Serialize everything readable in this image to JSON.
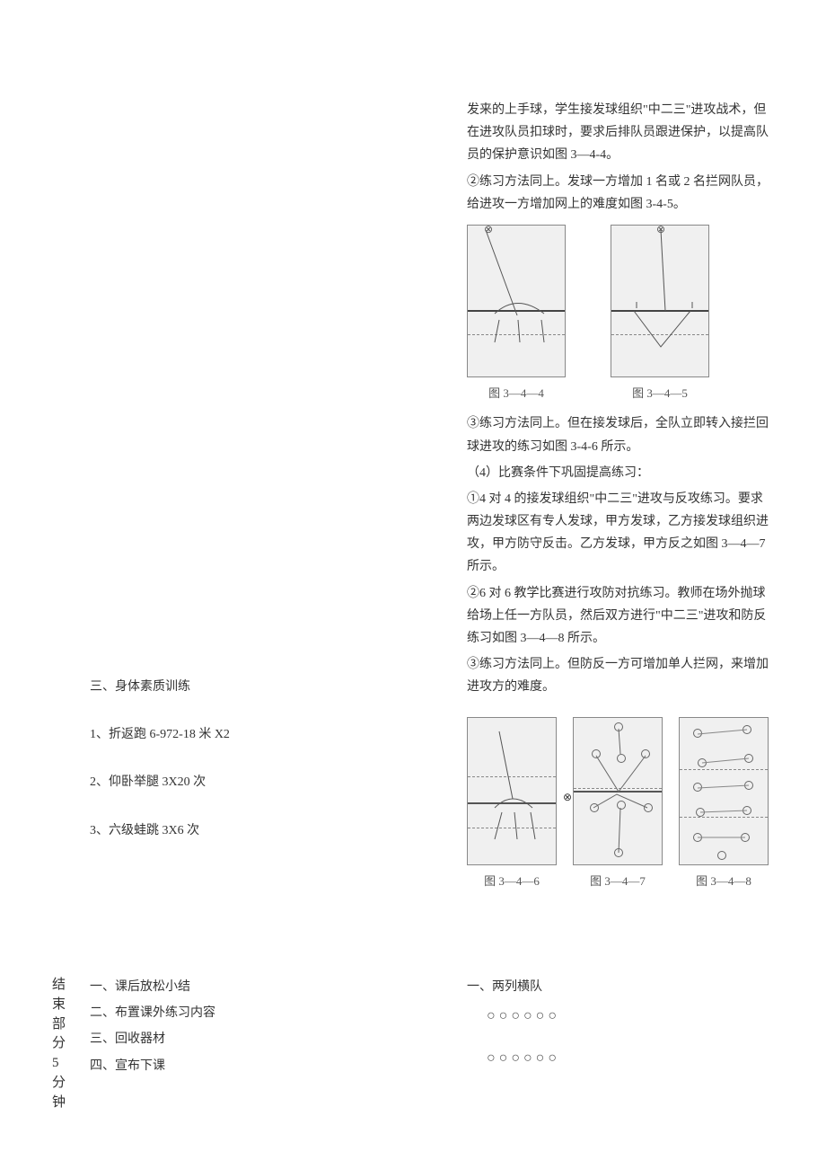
{
  "top_right": {
    "p1": "发来的上手球，学生接发球组织\"中二三\"进攻战术，但在进攻队员扣球时，要求后排队员跟进保护，以提高队员的保护意识如图 3—4-4。",
    "p2": "②练习方法同上。发球一方增加 1 名或 2 名拦网队员，给进攻一方增加网上的难度如图 3-4-5。",
    "cap1": "图 3—4—4",
    "cap2": "图 3—4—5",
    "p3": "③练习方法同上。但在接发球后，全队立即转入接拦回球进攻的练习如图 3-4-6 所示。",
    "p4": "（4）比赛条件下巩固提高练习：",
    "p5": "①4 对 4 的接发球组织\"中二三\"进攻与反攻练习。要求两边发球区有专人发球，甲方发球，乙方接发球组织进攻，甲方防守反击。乙方发球，甲方反之如图 3—4—7 所示。",
    "p6": "②6 对 6 教学比赛进行攻防对抗练习。教师在场外抛球给场上任一方队员，然后双方进行\"中二三\"进攻和防反练习如图 3—4—8 所示。",
    "p7": "③练习方法同上。但防反一方可增加单人拦网，来增加进攻方的难度。",
    "cap3": "图 3—4—6",
    "cap4": "图 3—4—7",
    "cap5": "图 3—4—8"
  },
  "left_col": {
    "h3": "三、身体素质训练",
    "i1": "1、折返跑 6-972-18 米 X2",
    "i2": "2、仰卧举腿 3X20 次",
    "i3": "3、六级蛙跳 3X6 次"
  },
  "bottom_label": {
    "c1": "结",
    "c2": "束",
    "c3": "部",
    "c4": "分",
    "c5": "5",
    "c6": "分",
    "c7": "钟"
  },
  "bottom_list": {
    "i1": "一、课后放松小结",
    "i2": "二、布置课外练习内容",
    "i3": "三、回收器材",
    "i4": "四、宣布下课"
  },
  "bottom_right": {
    "h": "一、两列横队",
    "row": "○○○○○○"
  }
}
